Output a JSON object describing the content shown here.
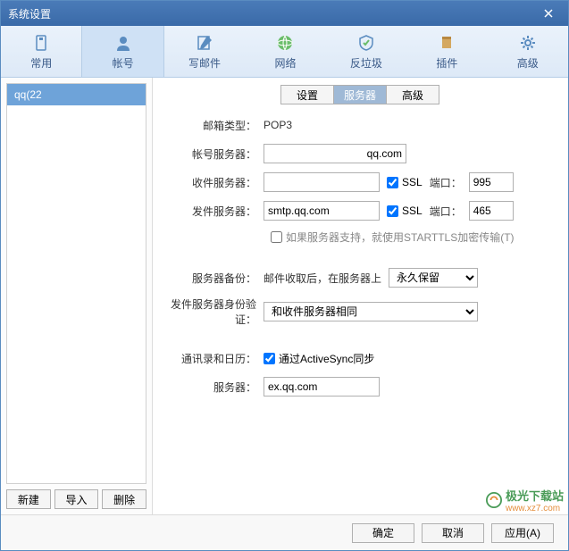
{
  "window": {
    "title": "系统设置"
  },
  "toolbar": {
    "tabs": [
      {
        "label": "常用"
      },
      {
        "label": "帐号"
      },
      {
        "label": "写邮件"
      },
      {
        "label": "网络"
      },
      {
        "label": "反垃圾"
      },
      {
        "label": "插件"
      },
      {
        "label": "高级"
      }
    ]
  },
  "sidebar": {
    "accounts": [
      {
        "label": "qq(22"
      }
    ],
    "buttons": {
      "new": "新建",
      "import": "导入",
      "delete": "删除"
    }
  },
  "subtabs": {
    "items": [
      "设置",
      "服务器",
      "高级"
    ]
  },
  "form": {
    "mailbox_type": {
      "label": "邮箱类型：",
      "value": "POP3"
    },
    "account_server": {
      "label": "帐号服务器：",
      "value": "qq.com"
    },
    "incoming": {
      "label": "收件服务器：",
      "value": "",
      "ssl": true,
      "ssl_label": "SSL",
      "port_label": "端口：",
      "port": "995"
    },
    "outgoing": {
      "label": "发件服务器：",
      "value": "smtp.qq.com",
      "ssl": true,
      "ssl_label": "SSL",
      "port_label": "端口：",
      "port": "465"
    },
    "starttls": {
      "label": "如果服务器支持，就使用STARTTLS加密传输(T)",
      "checked": false
    },
    "backup": {
      "label": "服务器备份：",
      "prefix": "邮件收取后，在服务器上",
      "value": "永久保留"
    },
    "auth": {
      "label": "发件服务器身份验证：",
      "value": "和收件服务器相同"
    },
    "contacts": {
      "label": "通讯录和日历：",
      "checkbox_label": "通过ActiveSync同步",
      "checked": true
    },
    "sync_server": {
      "label": "服务器：",
      "value": "ex.qq.com"
    }
  },
  "footer": {
    "ok": "确定",
    "cancel": "取消",
    "apply": "应用(A)"
  },
  "watermark": {
    "name": "极光下载站",
    "url": "www.xz7.com"
  }
}
